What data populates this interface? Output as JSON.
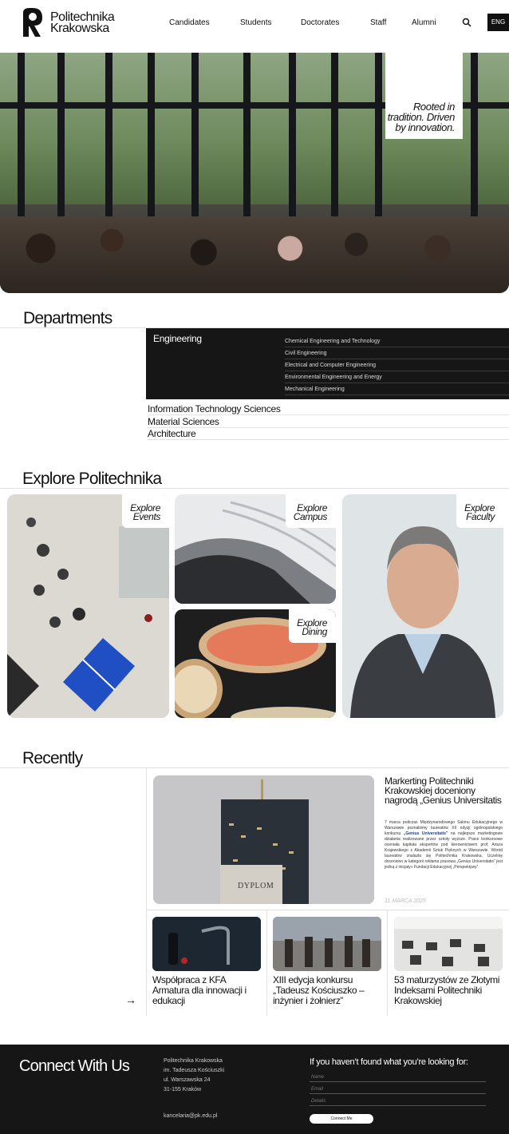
{
  "header": {
    "logo_line1": "Politechnika",
    "logo_line2": "Krakowska",
    "nav": [
      "Candidates",
      "Students",
      "Doctorates",
      "Staff",
      "Alumni"
    ],
    "lang": "ENG"
  },
  "hero": {
    "tagline": "Rooted in tradition. Driven by innovation."
  },
  "departments": {
    "title": "Departments",
    "active": {
      "label": "Engineering",
      "subitems": [
        "Chemical Engineering and Technology",
        "Civil Engineering",
        "Electrical and Computer Engineering",
        "Environmental Engineering and Energy",
        "Mechanical Engineering"
      ]
    },
    "others": [
      "Information Technology Sciences",
      "Material Sciences",
      "Architecture"
    ]
  },
  "explore": {
    "title": "Explore Politechnika",
    "tiles": [
      {
        "line1": "Explore",
        "line2": "Events"
      },
      {
        "line1": "Explore",
        "line2": "Campus"
      },
      {
        "line1": "Explore",
        "line2": "Dining"
      },
      {
        "line1": "Explore",
        "line2": "Faculty"
      }
    ]
  },
  "recently": {
    "title": "Recently",
    "main": {
      "image_caption": "DYPLOM",
      "title": "Markerting Politechniki Krakowskiej doceniony nagrodą „Genius Universitatis",
      "body_before": "7 marca podczas Międzynarodowego Salonu Edukacyjnego w Warszawie poznaliśmy laureatów XII edycji ogólnopolskiego konkursu ",
      "body_bold": "„Genius Universitatis”",
      "body_after": " na najlepsze marketingowe działania realizowane przez szkoły wyższe. Prace konkursowe oceniała kapituła ekspertów pod kierownictwem prof. Artura Krajewskiego z Akademii Sztuk Pięknych w Warszawie. Wśród laureatów znalazła się Politechnika Krakowska. Uczelnię doceniono w kategorii rekłama prasowa „Genius Universitatis” jest jedną z inicjaty» Fundacji Edukacyjnej „Perspektywy”.",
      "date": "11 MARCA 2025"
    },
    "items": [
      {
        "title": "Współpraca z KFA Armatura dla innowacji i edukacji"
      },
      {
        "title": "XIII edycja konkursu „Tadeusz Kościuszko – inżynier i żołnierz”"
      },
      {
        "title": "53 maturzystów ze Złotymi Indeksami Politechniki Krakowskiej"
      }
    ],
    "arrow": "→"
  },
  "footer": {
    "title": "Connect With Us",
    "address": [
      "Politechnika Krakowska",
      "im. Tadeusza Kościuszki",
      "ul. Warszawska 24",
      "31-155 Kraków"
    ],
    "email": "kancelaria@pk.edu.pl",
    "question": "If you haven’t found what you’re looking for:",
    "fields": {
      "name": "Name",
      "email": "Email",
      "details": "Details"
    },
    "submit": "Connect Me"
  }
}
